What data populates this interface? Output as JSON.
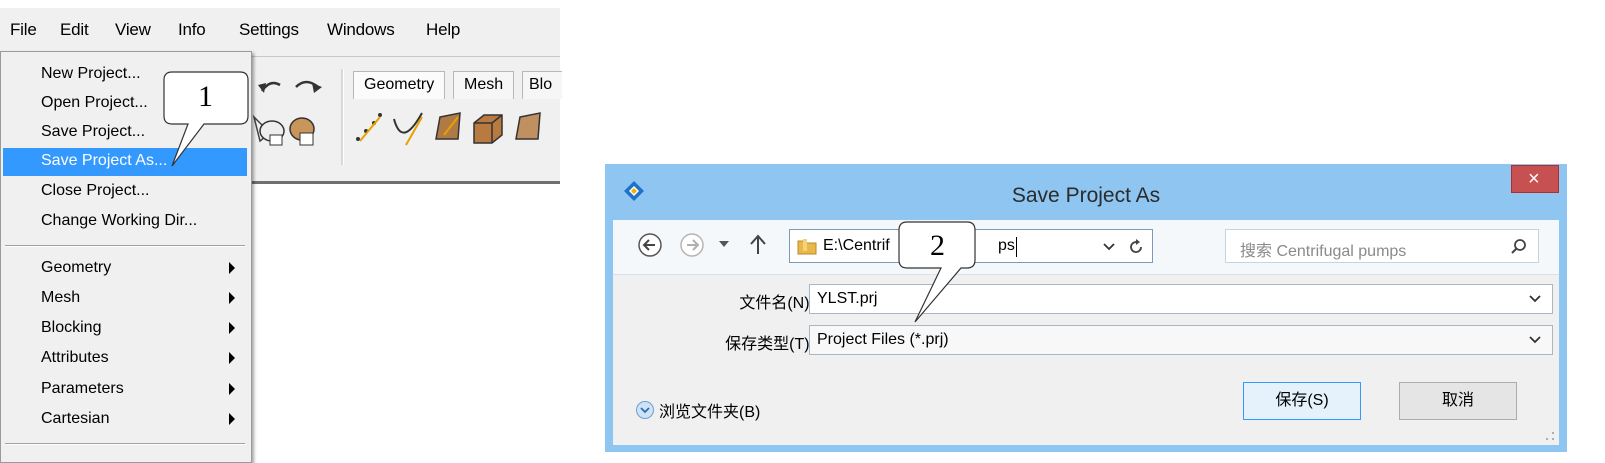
{
  "menubar": {
    "items": [
      "File",
      "Edit",
      "View",
      "Info",
      "Settings",
      "Windows",
      "Help"
    ]
  },
  "toolbar": {
    "tabs": [
      "Geometry",
      "Mesh",
      "Blo"
    ]
  },
  "file_menu": {
    "group1": [
      "New Project...",
      "Open Project...",
      "Save Project...",
      "Save Project As...",
      "Close Project...",
      "Change Working Dir..."
    ],
    "group2": [
      "Geometry",
      "Mesh",
      "Blocking",
      "Attributes",
      "Parameters",
      "Cartesian"
    ]
  },
  "callouts": {
    "one": "1",
    "two": "2"
  },
  "dialog": {
    "title": "Save Project As",
    "close_glyph": "×",
    "address": "E:\\Centrifugal pumps",
    "address_visible": "E:\\Centrif",
    "address_tail": "ps",
    "search_placeholder": "搜索 Centrifugal pumps",
    "filename_label": "文件名(N):",
    "filename_value": "YLST.prj",
    "filetype_label": "保存类型(T):",
    "filetype_value": "Project Files (*.prj)",
    "browse_folders": "浏览文件夹(B)",
    "save_button": "保存(S)",
    "cancel_button": "取消"
  },
  "colors": {
    "highlight": "#3399ff",
    "dialog_frame": "#8ec5f1",
    "close_button": "#c75050"
  },
  "icons": [
    "undo-icon",
    "redo-icon",
    "back-arrow-icon",
    "forward-arrow-icon",
    "up-arrow-icon",
    "folder-icon",
    "refresh-icon",
    "search-icon",
    "chevron-down-icon",
    "app-logo-icon"
  ]
}
